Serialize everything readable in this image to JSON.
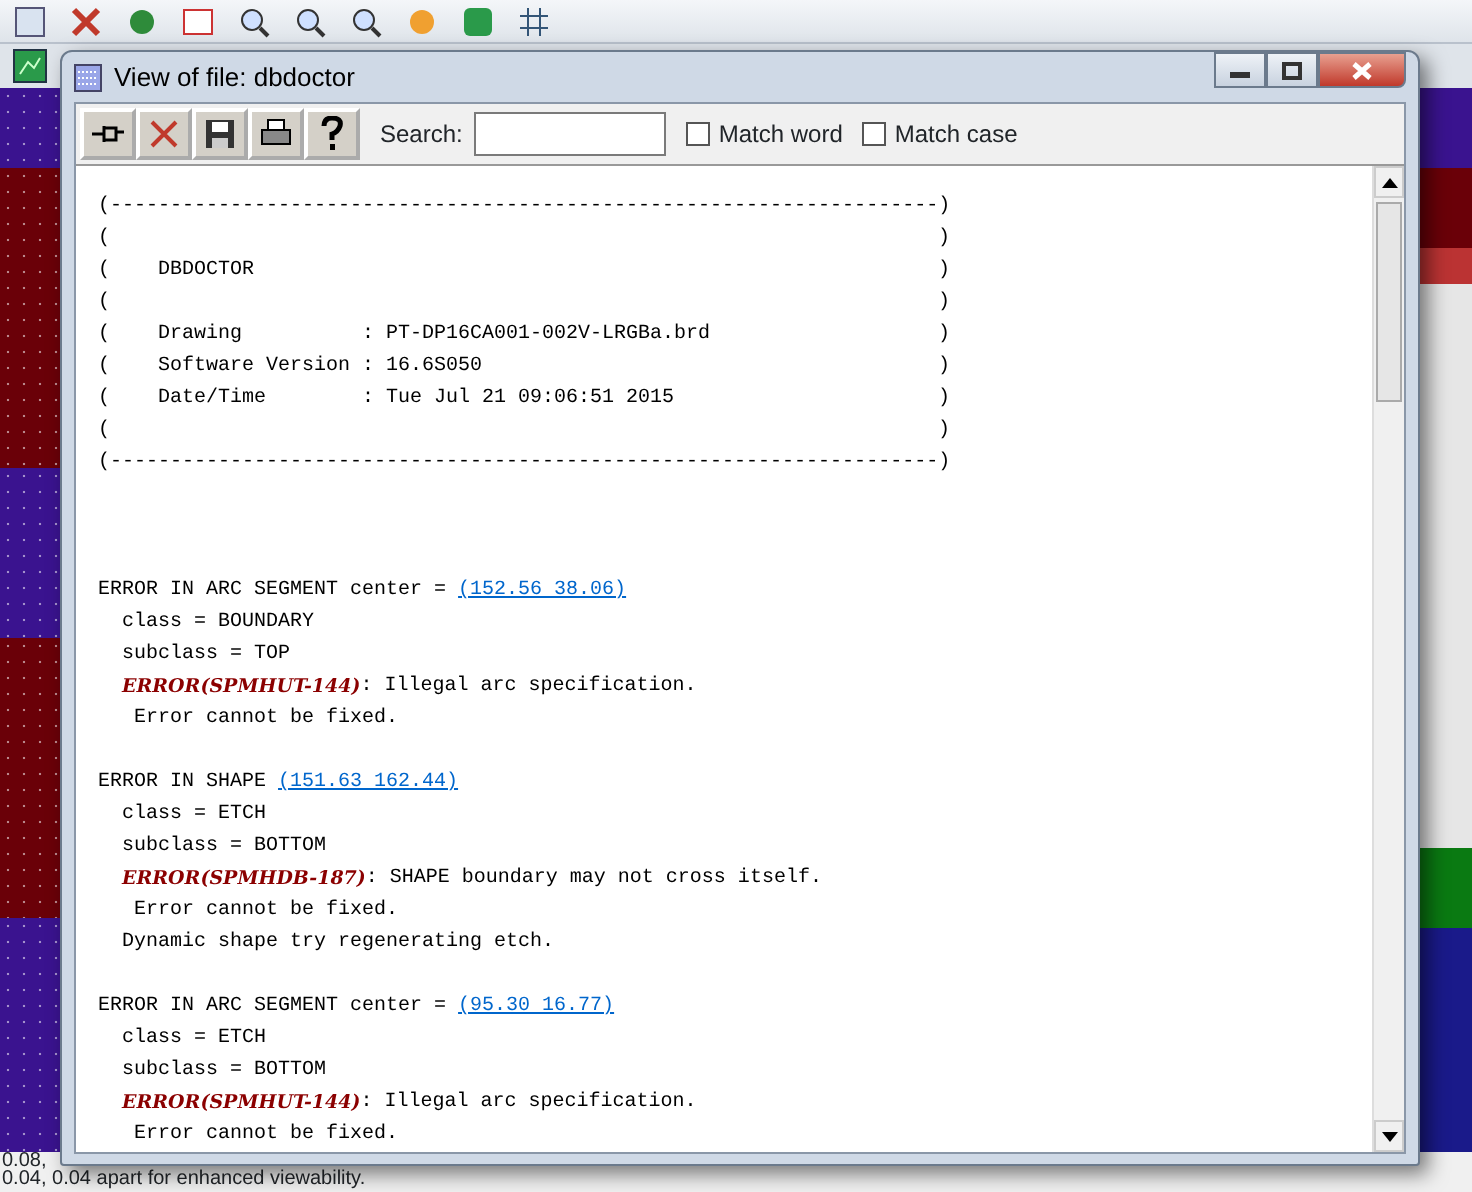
{
  "window": {
    "title": "View of file: dbdoctor"
  },
  "toolbar": {
    "search_label": "Search:",
    "options": [
      {
        "label": "Match word",
        "checked": false
      },
      {
        "label": "Match case",
        "checked": false
      }
    ]
  },
  "report": {
    "box": [
      {
        "kind": "rule",
        "text": "(---------------------------------------------------------------------)"
      },
      {
        "kind": "row",
        "open": "(",
        "close": ")"
      },
      {
        "kind": "row",
        "open": "(",
        "content": "DBDOCTOR",
        "close": ")"
      },
      {
        "kind": "row",
        "open": "(",
        "close": ")"
      },
      {
        "kind": "row",
        "open": "(",
        "content": "Drawing          : PT-DP16CA001-002V-LRGBa.brd",
        "close": ")"
      },
      {
        "kind": "row",
        "open": "(",
        "content": "Software Version : 16.6S050",
        "close": ")"
      },
      {
        "kind": "row",
        "open": "(",
        "content": "Date/Time        : Tue Jul 21 09:06:51 2015",
        "close": ")"
      },
      {
        "kind": "row",
        "open": "(",
        "close": ")"
      },
      {
        "kind": "rule",
        "text": "(---------------------------------------------------------------------)"
      }
    ],
    "lines": [
      {
        "kind": "heading",
        "text": "ERROR IN ARC SEGMENT center =",
        "link": "(152.56 38.06)"
      },
      {
        "kind": "detail",
        "text": "class = BOUNDARY"
      },
      {
        "kind": "detail",
        "text": "subclass = TOP"
      },
      {
        "kind": "error",
        "code": "ERROR(SPMHUT-144)",
        "text": ": Illegal arc specification."
      },
      {
        "kind": "note",
        "text": "Error cannot be fixed."
      },
      {
        "kind": "blank"
      },
      {
        "kind": "heading",
        "text": "ERROR IN SHAPE",
        "link": "(151.63 162.44)"
      },
      {
        "kind": "detail",
        "text": "class = ETCH"
      },
      {
        "kind": "detail",
        "text": "subclass = BOTTOM"
      },
      {
        "kind": "error",
        "code": "ERROR(SPMHDB-187)",
        "text": ": SHAPE boundary may not cross itself."
      },
      {
        "kind": "note",
        "text": "Error cannot be fixed."
      },
      {
        "kind": "detail",
        "text": "Dynamic shape try regenerating etch."
      },
      {
        "kind": "blank"
      },
      {
        "kind": "heading",
        "text": "ERROR IN ARC SEGMENT center =",
        "link": "(95.30 16.77)"
      },
      {
        "kind": "detail",
        "text": "class = ETCH"
      },
      {
        "kind": "detail",
        "text": "subclass = BOTTOM"
      },
      {
        "kind": "error",
        "code": "ERROR(SPMHUT-144)",
        "text": ": Illegal arc specification."
      },
      {
        "kind": "note",
        "text": "Error cannot be fixed."
      }
    ]
  },
  "status_lines": [
    "0.08,",
    "0.04, 0.04 apart for enhanced viewability."
  ]
}
